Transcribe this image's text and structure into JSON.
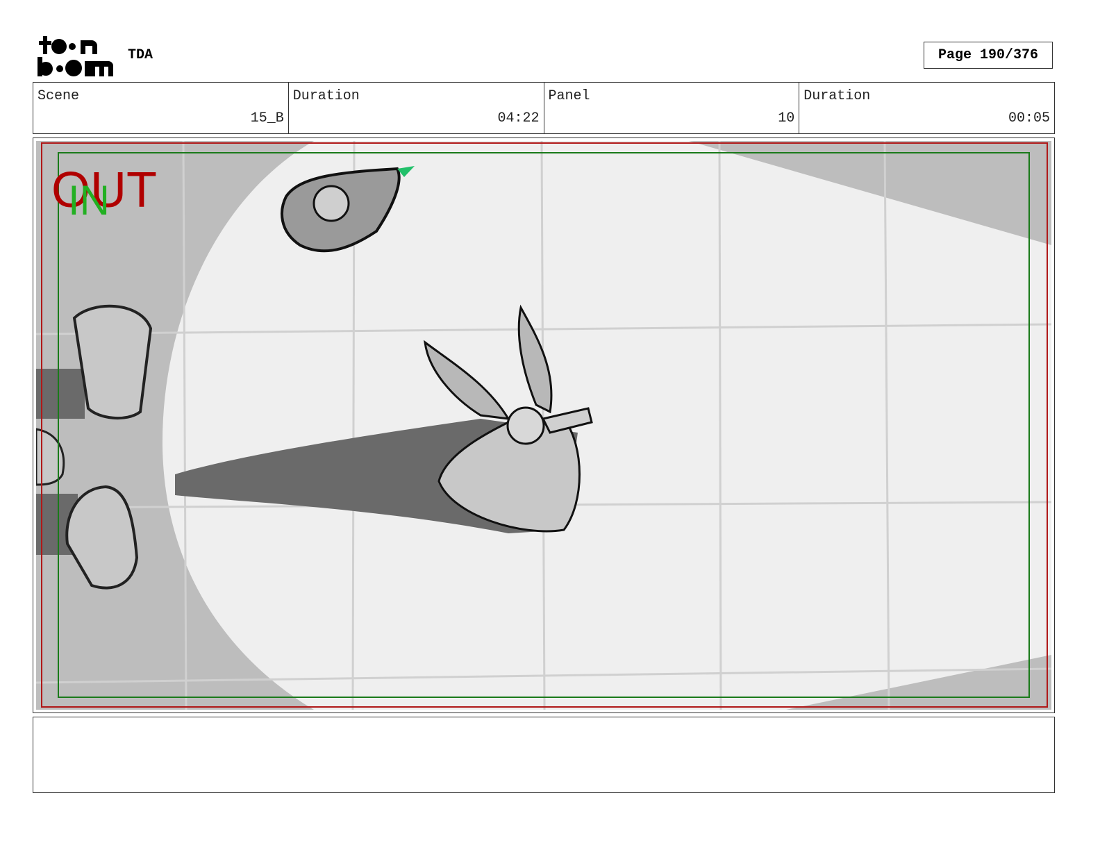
{
  "header": {
    "logo_text": "toon boom",
    "project": "TDA",
    "page_label": "Page 190/376"
  },
  "fields": [
    {
      "label": "Scene",
      "value": "15_B"
    },
    {
      "label": "Duration",
      "value": "04:22"
    },
    {
      "label": "Panel",
      "value": "10"
    },
    {
      "label": "Duration",
      "value": "00:05"
    }
  ],
  "panel": {
    "out_marker": "OUT",
    "in_marker": "IN",
    "colors": {
      "safe_frame": "#b01818",
      "title_frame": "#1a7a1a",
      "out_text": "#b00000",
      "in_text": "#22b022"
    }
  },
  "notes": {
    "text": ""
  }
}
